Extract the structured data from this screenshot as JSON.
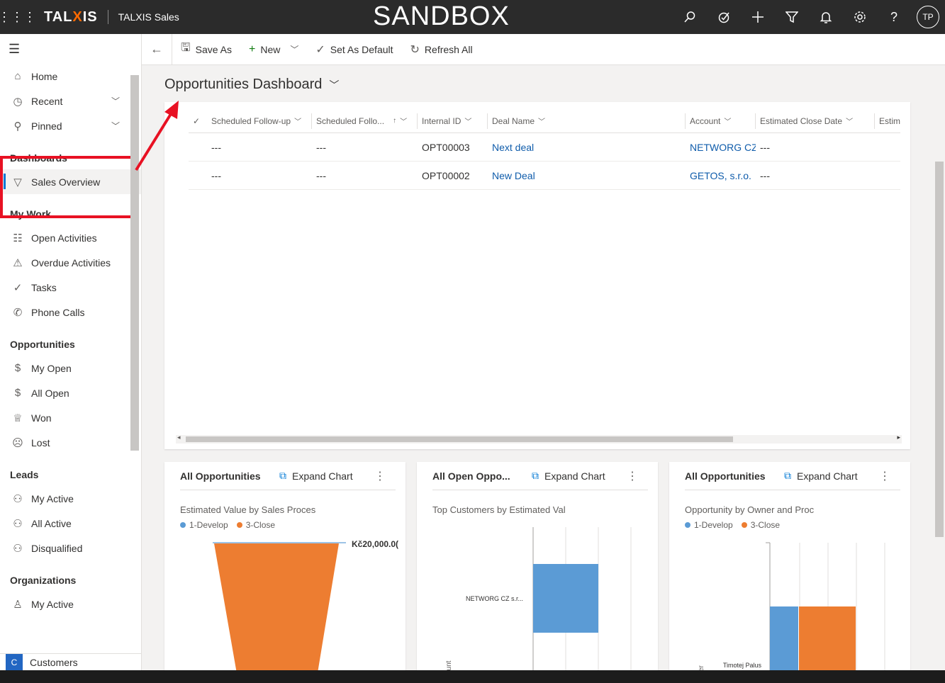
{
  "topbar": {
    "brand_left": "TAL",
    "brand_x": "X",
    "brand_right": "IS",
    "app_name": "TALXIS Sales",
    "environment": "SANDBOX",
    "user_initials": "TP",
    "icons": [
      "search-icon",
      "assistant-icon",
      "add-icon",
      "filter-icon",
      "bell-icon",
      "gear-icon",
      "help-icon"
    ]
  },
  "sidebar": {
    "top_items": [
      {
        "label": "Home",
        "icon": "home-icon"
      },
      {
        "label": "Recent",
        "icon": "clock-icon"
      },
      {
        "label": "Pinned",
        "icon": "pin-icon"
      }
    ],
    "sections": [
      {
        "title": "Dashboards",
        "items": [
          {
            "label": "Sales Overview",
            "icon": "dashboard-icon"
          }
        ]
      },
      {
        "title": "My Work",
        "items": [
          {
            "label": "Open Activities",
            "icon": "activity-icon"
          },
          {
            "label": "Overdue Activities",
            "icon": "warning-icon"
          },
          {
            "label": "Tasks",
            "icon": "task-icon"
          },
          {
            "label": "Phone Calls",
            "icon": "phone-icon"
          }
        ]
      },
      {
        "title": "Opportunities",
        "items": [
          {
            "label": "My Open",
            "icon": "dollar-icon"
          },
          {
            "label": "All Open",
            "icon": "dollar-icon"
          },
          {
            "label": "Won",
            "icon": "trophy-icon"
          },
          {
            "label": "Lost",
            "icon": "sad-icon"
          }
        ]
      },
      {
        "title": "Leads",
        "items": [
          {
            "label": "My Active",
            "icon": "lead-icon"
          },
          {
            "label": "All Active",
            "icon": "lead-icon"
          },
          {
            "label": "Disqualified",
            "icon": "lead-icon"
          }
        ]
      },
      {
        "title": "Organizations",
        "items": [
          {
            "label": "My Active",
            "icon": "org-icon"
          }
        ]
      }
    ],
    "area": {
      "badge": "C",
      "label": "Customers"
    }
  },
  "commandbar": {
    "save_as": "Save As",
    "new": "New",
    "set_default": "Set As Default",
    "refresh_all": "Refresh All"
  },
  "dashboard": {
    "title": "Opportunities Dashboard"
  },
  "grid": {
    "columns": [
      "Scheduled Follow-up",
      "Scheduled Follo...",
      "Internal ID",
      "Deal Name",
      "Account",
      "Estimated Close Date",
      "Estim"
    ],
    "rows": [
      {
        "c1": "---",
        "c2": "---",
        "id": "OPT00003",
        "deal": "Next deal",
        "account": "NETWORG CZ",
        "close": "---"
      },
      {
        "c1": "---",
        "c2": "---",
        "id": "OPT00002",
        "deal": "New Deal",
        "account": "GETOS, s.r.o.",
        "close": "---"
      }
    ]
  },
  "charts": {
    "expand_label": "Expand Chart",
    "cards": [
      {
        "title": "All Opportunities",
        "subtitle": "Estimated Value by Sales Proces",
        "legend": [
          "1-Develop",
          "3-Close"
        ]
      },
      {
        "title": "All Open Oppo...",
        "subtitle": "Top Customers by Estimated Val",
        "legend": []
      },
      {
        "title": "All Opportunities",
        "subtitle": "Opportunity by Owner and Proc",
        "legend": [
          "1-Develop",
          "3-Close"
        ]
      }
    ]
  },
  "colors": {
    "develop": "#5b9bd5",
    "close": "#ed7d31",
    "accent": "#0078d4",
    "highlight": "#e81123"
  },
  "chart_data": [
    {
      "type": "funnel",
      "title": "Estimated Value by Sales Proces",
      "series": [
        {
          "name": "1-Develop",
          "values": [
            0
          ]
        },
        {
          "name": "3-Close",
          "values": [
            20000
          ]
        }
      ],
      "labels": [
        "Kč20,000.0("
      ]
    },
    {
      "type": "bar",
      "title": "Top Customers by Estimated Val",
      "categories": [
        "NETWORG CZ s.r..."
      ],
      "values": [
        1
      ],
      "ylabel": "ount"
    },
    {
      "type": "bar",
      "title": "Opportunity by Owner and Proc",
      "categories": [
        "Timotej Palus"
      ],
      "series": [
        {
          "name": "1-Develop",
          "values": [
            1
          ]
        },
        {
          "name": "3-Close",
          "values": [
            1
          ]
        }
      ],
      "ylabel": "er"
    }
  ]
}
